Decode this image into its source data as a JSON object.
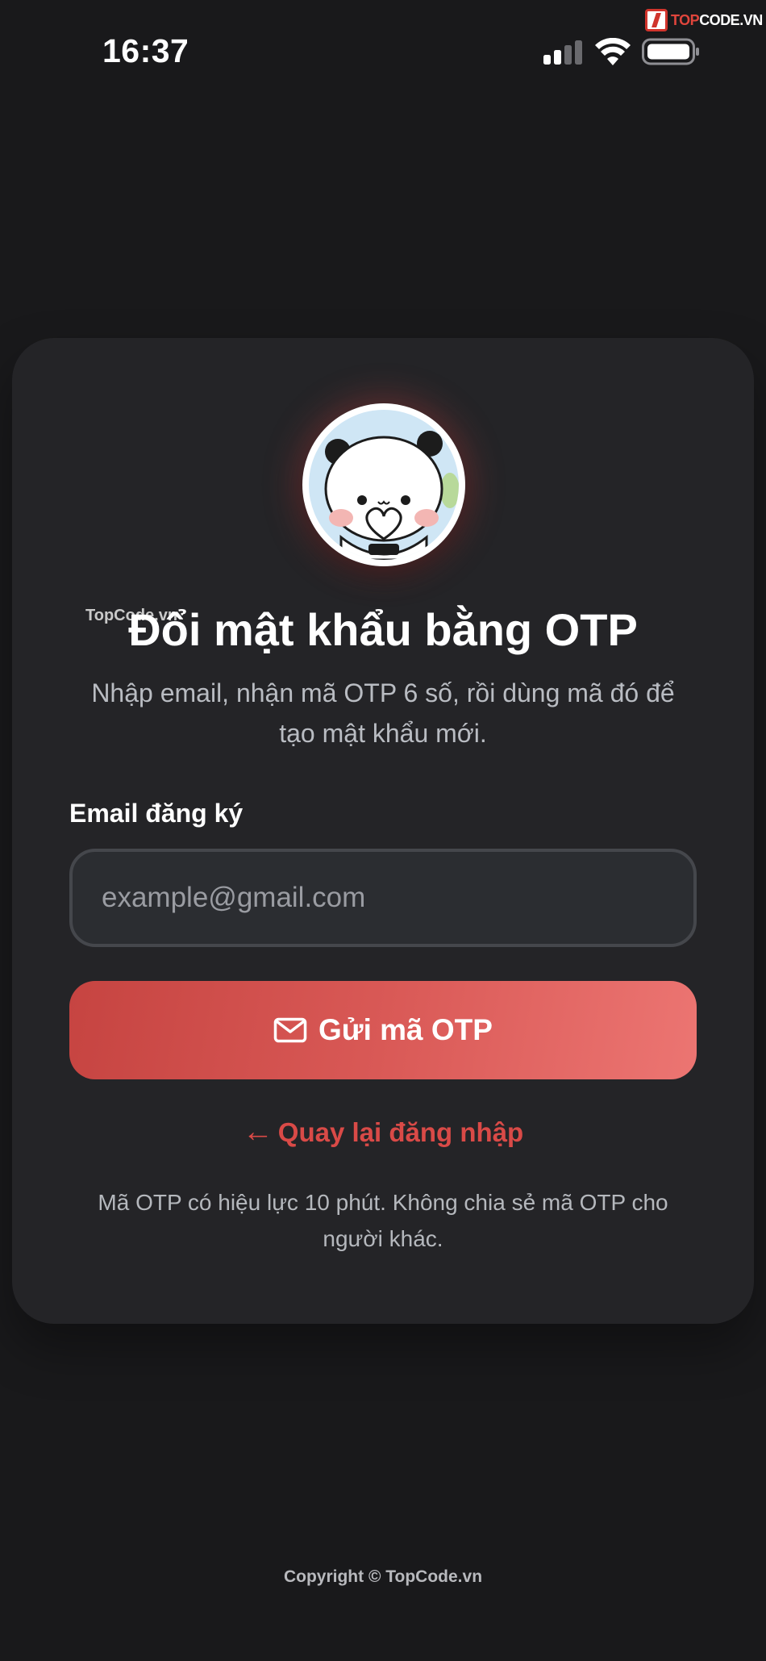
{
  "status_bar": {
    "time": "16:37",
    "signal_icon": "cellular-signal-icon",
    "wifi_icon": "wifi-icon",
    "battery_icon": "battery-icon"
  },
  "watermark": {
    "brand_prefix": "TOP",
    "brand_suffix": "CODE.VN",
    "small_text": "TopCode.vn"
  },
  "card": {
    "avatar_icon": "panda-heart-avatar",
    "title": "Đổi mật khẩu bằng OTP",
    "subtitle": "Nhập email, nhận mã OTP 6 số, rồi dùng mã đó để tạo mật khẩu mới.",
    "email_label": "Email đăng ký",
    "email_placeholder": "example@gmail.com",
    "email_value": "",
    "send_button_label": "Gửi mã OTP",
    "send_button_icon": "envelope-icon",
    "back_arrow": "←",
    "back_link_label": "Quay lại đăng nhập",
    "note": "Mã OTP có hiệu lực 10 phút. Không chia sẻ mã OTP cho người khác."
  },
  "footer": {
    "copyright": "Copyright © TopCode.vn"
  },
  "colors": {
    "background": "#19191b",
    "card": "#242427",
    "accent": "#d94a47",
    "button_gradient_start": "#c64441",
    "button_gradient_end": "#ec7572"
  }
}
